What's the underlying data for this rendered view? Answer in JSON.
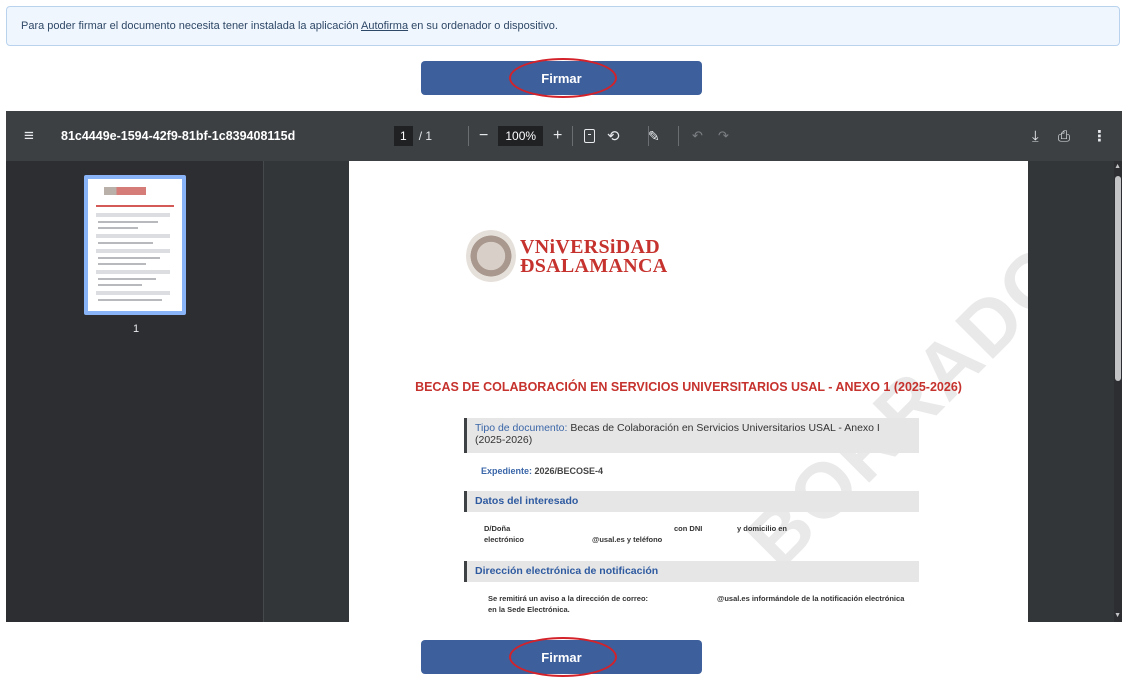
{
  "notice": {
    "before": "Para poder firmar el documento necesita tener instalada la aplicación ",
    "link": "Autofirma",
    "after": " en su ordenador o dispositivo."
  },
  "sign_label": "Firmar",
  "viewer": {
    "file_name": "81c4449e-1594-42f9-81bf-1c839408115d",
    "page_current": "1",
    "page_total": "/ 1",
    "zoom": "100%",
    "thumbnail_label": "1"
  },
  "icons": {
    "menu": "menu-icon",
    "zoom_out": "minus-icon",
    "zoom_in": "plus-icon",
    "fit": "fit-page-icon",
    "rotate": "rotate-icon",
    "annotate": "pen-icon",
    "undo": "undo-icon",
    "redo": "redo-icon",
    "download": "download-icon",
    "print": "print-icon",
    "more": "more-vert-icon"
  },
  "document": {
    "university_line1": "VNiVERSiDAD",
    "university_line2": "ÐSALAMANCA",
    "title": "BECAS DE COLABORACIÓN EN SERVICIOS UNIVERSITARIOS USAL - ANEXO 1 (2025-2026)",
    "tipo_label": "Tipo de documento:",
    "tipo_value": " Becas de Colaboración en Servicios Universitarios USAL - Anexo I (2025-2026)",
    "expediente_label": "Expediente:",
    "expediente_value": " 2026/BECOSE-4",
    "datos_header": "Datos del interesado",
    "datos_line1_a": "D/Doña",
    "datos_line1_b": "con DNI",
    "datos_line1_c": "y domicilio en",
    "datos_line2_a": "electrónico",
    "datos_line2_b": "@usal.es y teléfono",
    "dir_header": "Dirección electrónica de notificación",
    "dir_line1_a": "Se remitirá un aviso a la dirección de correo:",
    "dir_line1_b": "@usal.es informándole de la notificación electrónica",
    "dir_line2": "en la Sede Electrónica."
  },
  "colors": {
    "accent_button": "#3d5f9c",
    "highlight_ring": "#d3222a",
    "doc_red": "#c6322d",
    "viewer_bg": "#323639"
  }
}
